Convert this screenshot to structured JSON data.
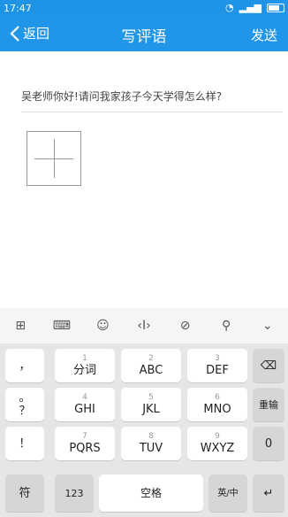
{
  "status_bar": {
    "time": "17:47"
  },
  "nav": {
    "back_label": "返回",
    "title": "写评语",
    "send_label": "发送"
  },
  "comment_text": "吴老师你好!请问我家孩子今天学得怎么样?",
  "toolbar": {
    "icons": [
      "grid-icon",
      "keyboard-icon",
      "emoji-icon",
      "cursor-icon",
      "link-icon",
      "search-icon",
      "chevron-down-icon"
    ],
    "glyphs": [
      "⊞",
      "⌨",
      "☺",
      "‹I›",
      "⊘",
      "⚲",
      "⌄"
    ]
  },
  "keyboard": {
    "row1": {
      "punct": "，",
      "k1_num": "1",
      "k1_label": "分词",
      "k2_num": "2",
      "k2_label": "ABC",
      "k3_num": "3",
      "k3_label": "DEF",
      "side": "⌫"
    },
    "row2": {
      "punct": "。",
      "k1_num": "4",
      "k1_label": "GHI",
      "k2_num": "5",
      "k2_label": "JKL",
      "k3_num": "6",
      "k3_label": "MNO",
      "side": "重输"
    },
    "row2b": {
      "punct": "？"
    },
    "row3": {
      "punct": "！",
      "k1_num": "7",
      "k1_label": "PQRS",
      "k2_num": "8",
      "k2_label": "TUV",
      "k3_num": "9",
      "k3_label": "WXYZ",
      "side": "0"
    },
    "row4": {
      "sym": "符",
      "num": "123",
      "space": "空格",
      "lang": "英/中",
      "enter": "↵"
    }
  }
}
